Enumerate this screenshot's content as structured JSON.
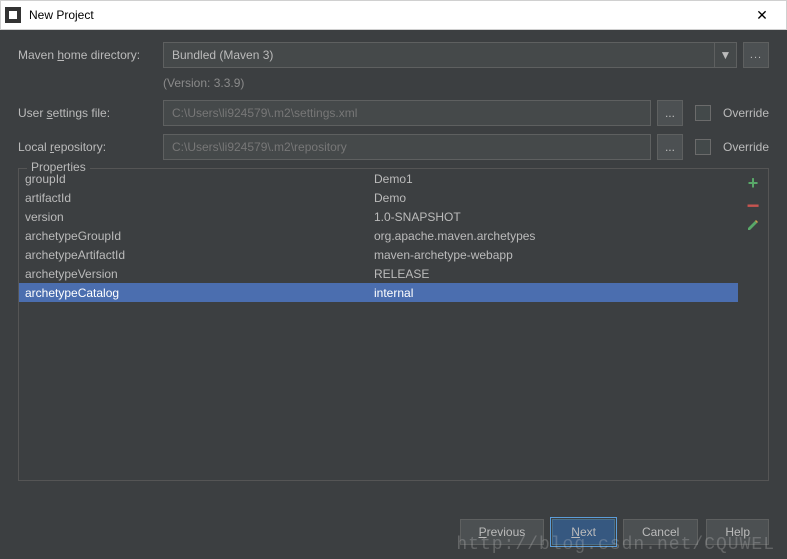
{
  "window": {
    "title": "New Project",
    "close": "✕"
  },
  "labels": {
    "mavenHomePrefix": "Maven ",
    "mavenHomeU": "h",
    "mavenHomeSuffix": "ome directory:",
    "userSettingsPrefix": "User ",
    "userSettingsU": "s",
    "userSettingsSuffix": "ettings file:",
    "localRepoPrefix": "Local ",
    "localRepoU": "r",
    "localRepoSuffix": "epository:",
    "properties": "Properties"
  },
  "mavenHome": {
    "value": "Bundled (Maven 3)",
    "version": "(Version: 3.3.9)",
    "ellipsis": "..."
  },
  "userSettings": {
    "path": "C:\\Users\\li924579\\.m2\\settings.xml",
    "browse": "...",
    "override": "Override"
  },
  "localRepo": {
    "path": "C:\\Users\\li924579\\.m2\\repository",
    "browse": "...",
    "override": "Override"
  },
  "properties": [
    {
      "key": "groupId",
      "value": "Demo1"
    },
    {
      "key": "artifactId",
      "value": "Demo"
    },
    {
      "key": "version",
      "value": "1.0-SNAPSHOT"
    },
    {
      "key": "archetypeGroupId",
      "value": "org.apache.maven.archetypes"
    },
    {
      "key": "archetypeArtifactId",
      "value": "maven-archetype-webapp"
    },
    {
      "key": "archetypeVersion",
      "value": "RELEASE"
    },
    {
      "key": "archetypeCatalog",
      "value": "internal"
    }
  ],
  "selectedIndex": 6,
  "actions": {
    "add": "+",
    "remove": "−"
  },
  "buttons": {
    "previousU": "P",
    "previousSuffix": "revious",
    "nextU": "N",
    "nextSuffix": "ext",
    "cancel": "Cancel",
    "help": "Help"
  },
  "watermark": "http://blog.csdn.net/CQUWEL"
}
